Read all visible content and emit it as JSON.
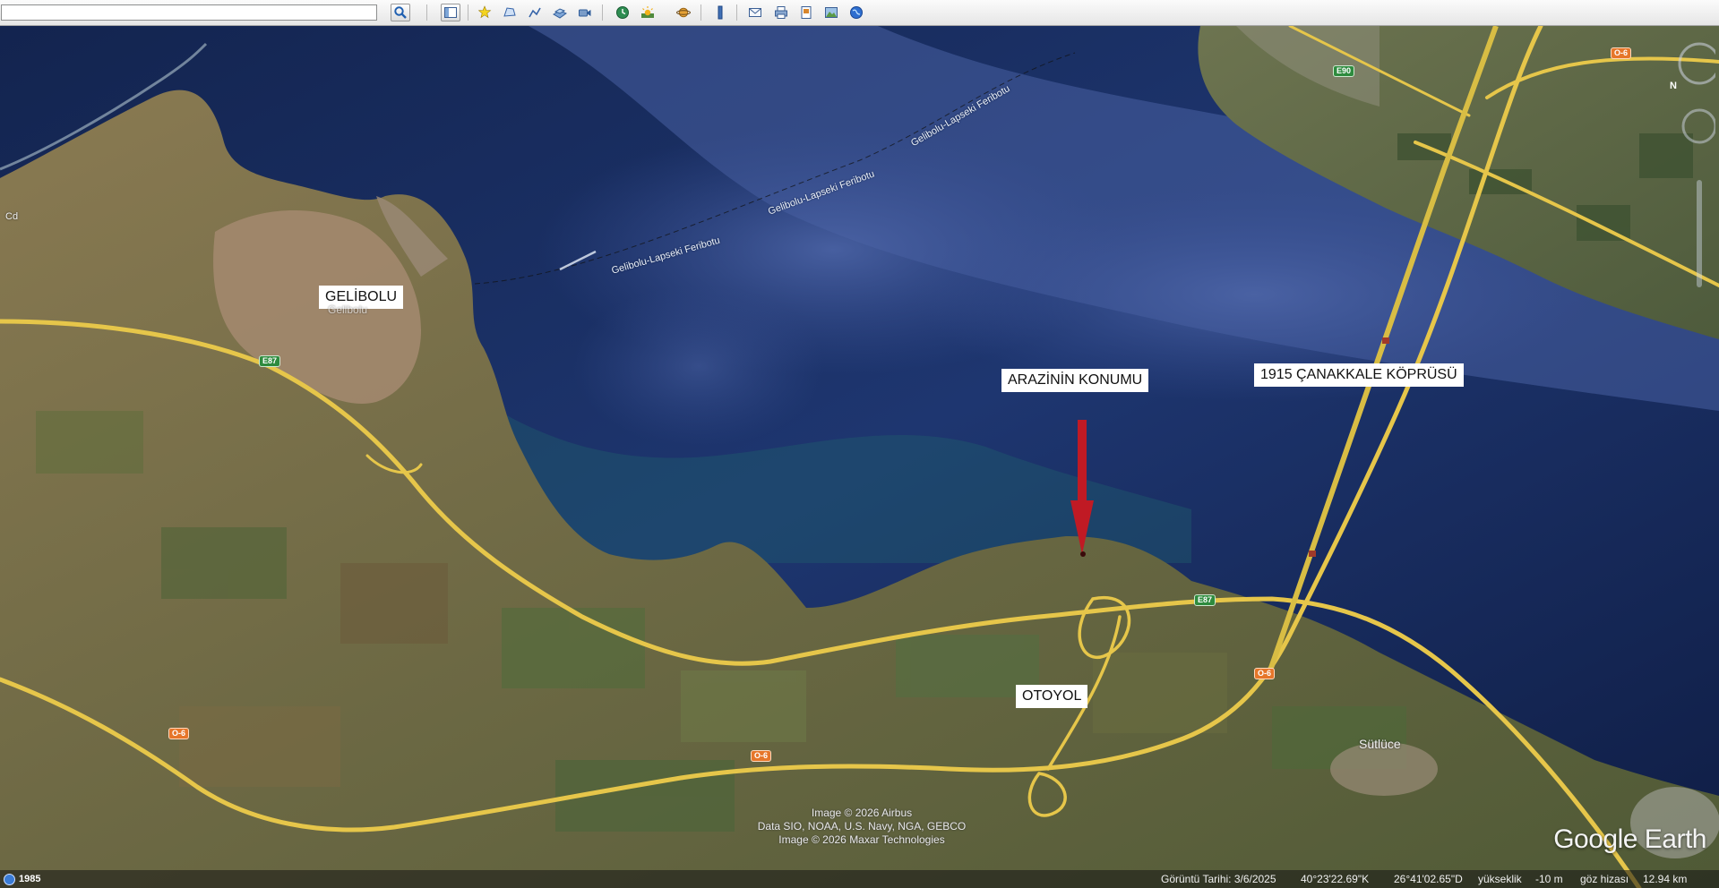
{
  "toolbar": {
    "search_value": "",
    "buttons": [
      {
        "name": "search-icon",
        "color": "#2f6fbf"
      },
      {
        "name": "sidebar-toggle-icon"
      },
      {
        "name": "add-placemark-icon"
      },
      {
        "name": "add-polygon-icon"
      },
      {
        "name": "add-path-icon"
      },
      {
        "name": "add-image-overlay-icon"
      },
      {
        "name": "record-tour-icon"
      },
      {
        "name": "historical-imagery-icon"
      },
      {
        "name": "sunlight-icon"
      },
      {
        "name": "switch-planet-icon"
      },
      {
        "name": "ruler-icon"
      },
      {
        "name": "email-icon"
      },
      {
        "name": "print-icon"
      },
      {
        "name": "save-image-icon"
      },
      {
        "name": "view-in-maps-icon"
      },
      {
        "name": "earth-gallery-icon"
      }
    ]
  },
  "map": {
    "labels": {
      "gelibolu": "GELİBOLU",
      "arazi": "ARAZİNİN KONUMU",
      "kopru": "1915 ÇANAKKALE KÖPRÜSÜ",
      "otoyol": "OTOYOL"
    },
    "ferry_labels": [
      "Gelibolu-Lapseki Feribotu",
      "Gelibolu-Lapseki Feribotu",
      "Gelibolu-Lapseki Feribotu"
    ],
    "town_labels": {
      "sutluce": "Sütlüce",
      "gelibolu_base": "Gelibolu",
      "cd": "Cd"
    },
    "road_shields": {
      "e87_west": "E87",
      "e87_east": "E87",
      "e90": "E90",
      "o6_a": "O-6",
      "o6_b": "O-6",
      "o6_c": "O-6",
      "o6_d": "O-6"
    },
    "credits": [
      "Image © 2026 Airbus",
      "Data SIO, NOAA, U.S. Navy, NGA, GEBCO",
      "Image © 2026 Maxar Technologies"
    ],
    "logo": "Google Earth",
    "colors": {
      "arrow": "#c01a24",
      "road": "#e9c94a",
      "sea": "#1d3468"
    }
  },
  "status": {
    "year": "1985",
    "imagery_date": "Görüntü Tarihi: 3/6/2025",
    "lat": "40°23'22.69\"K",
    "lon": "26°41'02.65\"D",
    "elevation_label": "yükseklik",
    "elevation": "-10 m",
    "eye_alt_label": "göz hizası",
    "eye_alt": "12.94 km"
  }
}
